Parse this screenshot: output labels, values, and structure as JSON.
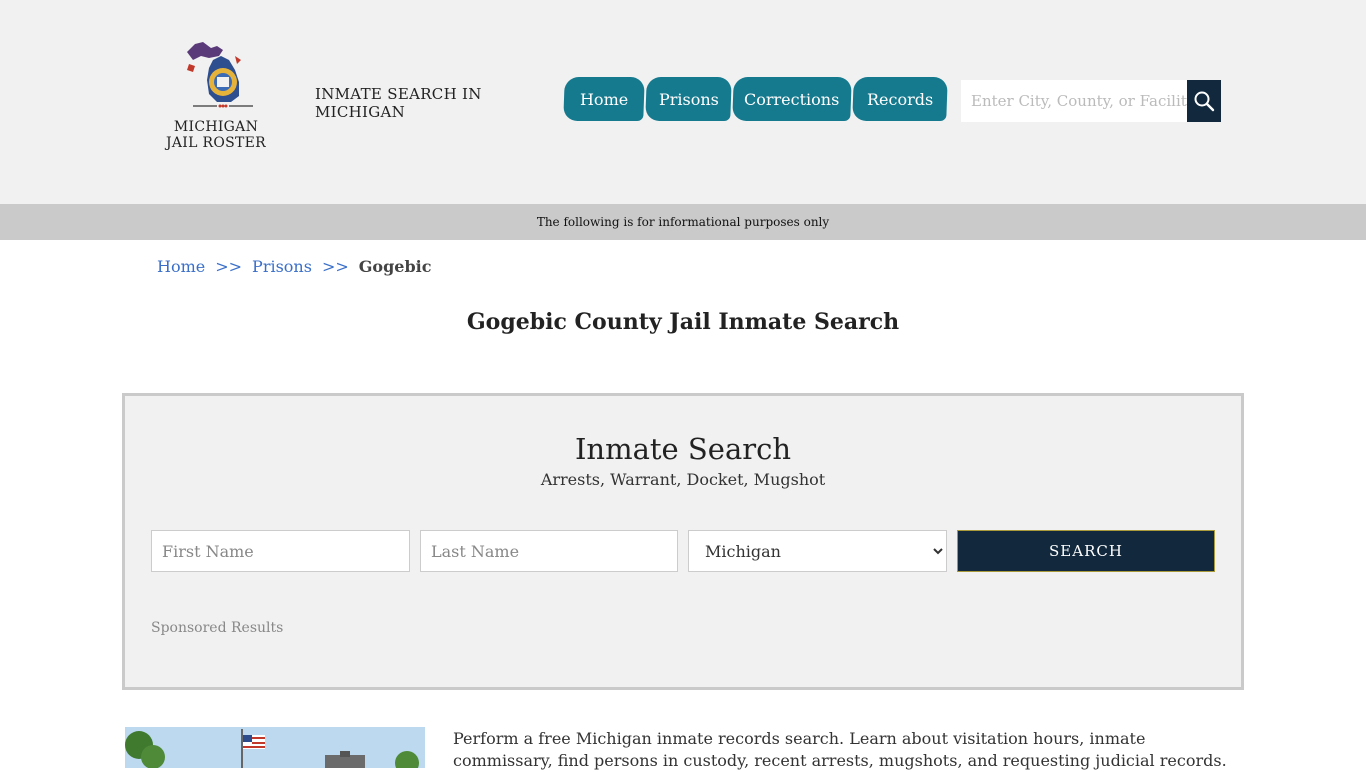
{
  "header": {
    "logo_alt_line1": "MICHIGAN",
    "logo_alt_line2": "JAIL ROSTER",
    "site_title": "INMATE SEARCH IN MICHIGAN"
  },
  "nav": {
    "items": [
      {
        "label": "Home"
      },
      {
        "label": "Prisons"
      },
      {
        "label": "Corrections"
      },
      {
        "label": "Records"
      }
    ]
  },
  "site_search": {
    "placeholder": "Enter City, County, or Facility",
    "icon": "search-icon"
  },
  "banner": {
    "text": "The following is for informational purposes only"
  },
  "breadcrumb": {
    "items": [
      "Home",
      "Prisons"
    ],
    "separator": ">>",
    "current": "Gogebic"
  },
  "page": {
    "title": "Gogebic County Jail Inmate Search"
  },
  "inmate_search": {
    "title": "Inmate Search",
    "subtitle": "Arrests, Warrant, Docket, Mugshot",
    "first_name_placeholder": "First Name",
    "last_name_placeholder": "Last Name",
    "state_selected": "Michigan",
    "submit_label": "SEARCH",
    "sponsored_label": "Sponsored Results"
  },
  "intro": {
    "text": "Perform a free Michigan inmate records search. Learn about visitation hours, inmate commissary, find persons in custody, recent arrests, mugshots, and requesting judicial records."
  },
  "colors": {
    "nav_bg": "#167a8f",
    "dark_navy": "#11283d",
    "header_bg": "#f1f1f1",
    "banner_bg": "#cacaca",
    "link": "#3a6fc9"
  }
}
